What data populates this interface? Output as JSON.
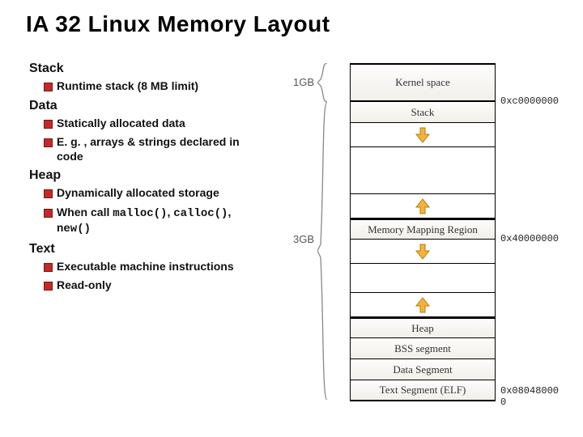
{
  "title": "IA 32 Linux Memory Layout",
  "sections": {
    "stack": {
      "heading": "Stack",
      "items": [
        "Runtime stack (8 MB limit)"
      ]
    },
    "data": {
      "heading": "Data",
      "items": [
        "Statically allocated data",
        "E. g. , arrays & strings declared in code"
      ]
    },
    "heap": {
      "heading": "Heap",
      "items": [
        "Dynamically allocated storage",
        "When call malloc(), calloc(), new()"
      ]
    },
    "text": {
      "heading": "Text",
      "items": [
        "Executable machine instructions",
        "Read-only"
      ]
    }
  },
  "diagram": {
    "size_labels": {
      "top": "1GB",
      "bottom": "3GB"
    },
    "segments": {
      "kernel": "Kernel space",
      "stack": "Stack",
      "mmap": "Memory Mapping Region",
      "heap": "Heap",
      "bss": "BSS segment",
      "data": "Data Segment",
      "text": "Text Segment (ELF)"
    },
    "addresses": {
      "kernel_base": "0xc0000000",
      "mmap_base": "0x40000000",
      "text_base": "0x08048000",
      "zero": "0"
    }
  }
}
